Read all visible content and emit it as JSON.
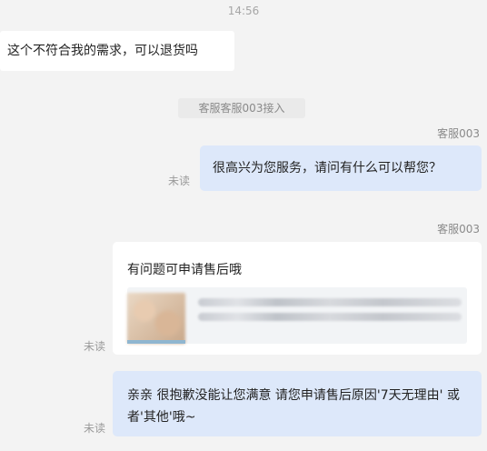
{
  "timestamp": "14:56",
  "messages": {
    "customer_message": "这个不符合我的需求，可以退货吗",
    "system_notice": "客服客服003接入",
    "agent_name_1": "客服003",
    "read_status_1": "未读",
    "agent_reply_1": "很高兴为您服务，请问有什么可以帮您？",
    "agent_name_2": "客服003",
    "card_text": "有问题可申请售后哦",
    "read_status_2": "未读",
    "agent_reply_2": "亲亲  很抱歉没能让您满意 请您申请售后原因'7天无理由' 或者'其他'哦~",
    "read_status_3": "未读"
  },
  "colors": {
    "agent_bubble": "#dde8fa",
    "customer_bubble": "#ffffff",
    "background": "#f3f3f3"
  }
}
